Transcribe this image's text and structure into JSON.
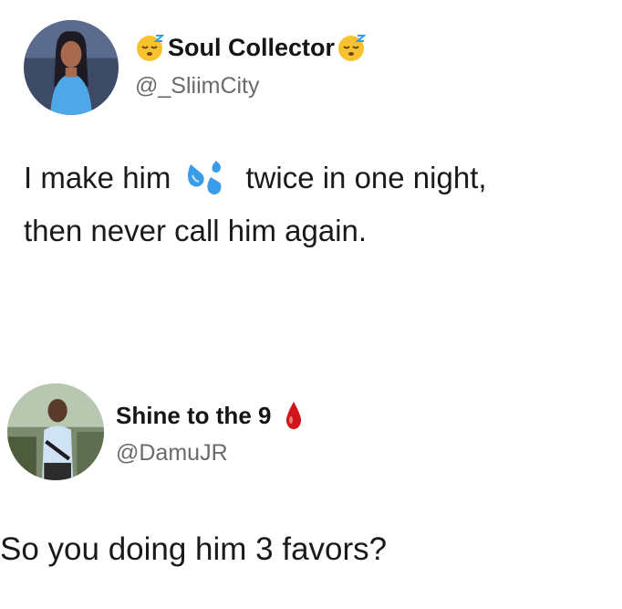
{
  "tweets": [
    {
      "author": {
        "name": "Soul Collector",
        "handle": "@_SliimCity",
        "emoji_left": "sleepy-face-emoji",
        "emoji_right": "sleepy-face-emoji"
      },
      "text": {
        "part1": "I make him",
        "emoji": "sweat-droplets-emoji",
        "part2": "twice in one night,",
        "line2": "then never call him again."
      }
    },
    {
      "author": {
        "name": "Shine to the 9",
        "handle": "@DamuJR",
        "emoji": "drop-of-blood-emoji"
      },
      "text": {
        "line1": "So you doing him 3 favors?"
      }
    }
  ],
  "colors": {
    "background": "#ffffff",
    "text": "#151515",
    "handle": "#6b6b6b",
    "emoji_yellow": "#f7c22d",
    "sweat_blue": "#3a9be6",
    "blood_red": "#d0151c"
  }
}
